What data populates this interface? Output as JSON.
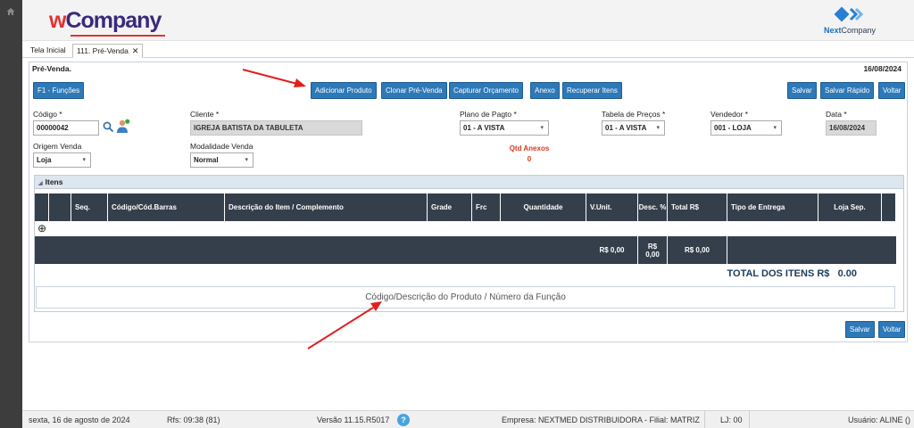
{
  "brand": {
    "logo_prefix": "w",
    "logo_rest": "Company",
    "nextcompany_logo_text_a": "Next",
    "nextcompany_logo_text_b": "Company"
  },
  "tabs": [
    {
      "label": "Tela Inicial"
    },
    {
      "label": "111. Pré-Venda",
      "close": "✕"
    }
  ],
  "panel": {
    "title": "Pré-Venda.",
    "date": "16/08/2024"
  },
  "toolbar": {
    "functions": "F1 - Funções",
    "add_product": "Adicionar Produto",
    "clone": "Clonar Pré-Venda",
    "capture_quote": "Capturar Orçamento",
    "attachment": "Anexo",
    "recover_items": "Recuperar Itens",
    "save": "Salvar",
    "quick_save": "Salvar Rápido",
    "back": "Voltar"
  },
  "form": {
    "codigo": {
      "label": "Código *",
      "value": "00000042"
    },
    "cliente": {
      "label": "Cliente *",
      "value": "IGREJA BATISTA DA TABULETA"
    },
    "plano": {
      "label": "Plano de Pagto *",
      "value": "01 - A VISTA"
    },
    "tabela": {
      "label": "Tabela de Preços *",
      "value": "01 - A VISTA"
    },
    "vendedor": {
      "label": "Vendedor *",
      "value": "001 - LOJA"
    },
    "data": {
      "label": "Data *",
      "value": "16/08/2024"
    },
    "origem": {
      "label": "Origem Venda",
      "value": "Loja"
    },
    "modalidade": {
      "label": "Modalidade Venda",
      "value": "Normal"
    },
    "anexos": {
      "label": "Qtd Anexos",
      "value": "0"
    }
  },
  "items": {
    "title": "Itens",
    "columns": [
      "Seq.",
      "Código/Cód.Barras",
      "Descrição do Item / Complemento",
      "Grade",
      "Frc",
      "Quantidade",
      "V.Unit.",
      "Desc. %",
      "Total R$",
      "Tipo de Entrega",
      "Loja Sep."
    ],
    "add_symbol": "⊕",
    "totals": {
      "vunit": "R$ 0,00",
      "desc_currency": "R$",
      "desc_value": "0,00",
      "total": "R$ 0,00"
    },
    "total_label": "TOTAL DOS ITENS R$",
    "total_value": "0.00",
    "search_placeholder": "Código/Descrição do Produto / Número da Função"
  },
  "bottom_toolbar": {
    "save": "Salvar",
    "back": "Voltar"
  },
  "status": {
    "date": "sexta, 16 de agosto de 2024",
    "rfs": "Rfs: 09:38 (81)",
    "version": "Versão 11.15.R5017",
    "company": "Empresa: NEXTMED DISTRIBUIDORA - Filial: MATRIZ",
    "lj": "LJ: 00",
    "user": "Usuário: ALINE ()"
  },
  "colors": {
    "primary_button": "#2e79b8",
    "grid_header": "#343f4b",
    "accent_red": "#d43a1a",
    "annotation_arrow": "#e02020"
  },
  "icons": [
    "home-icon",
    "search-icon",
    "client-user-icon",
    "help-icon",
    "close-icon",
    "dropdown-caret-icon",
    "add-circle-icon",
    "collapse-triangle-icon"
  ]
}
